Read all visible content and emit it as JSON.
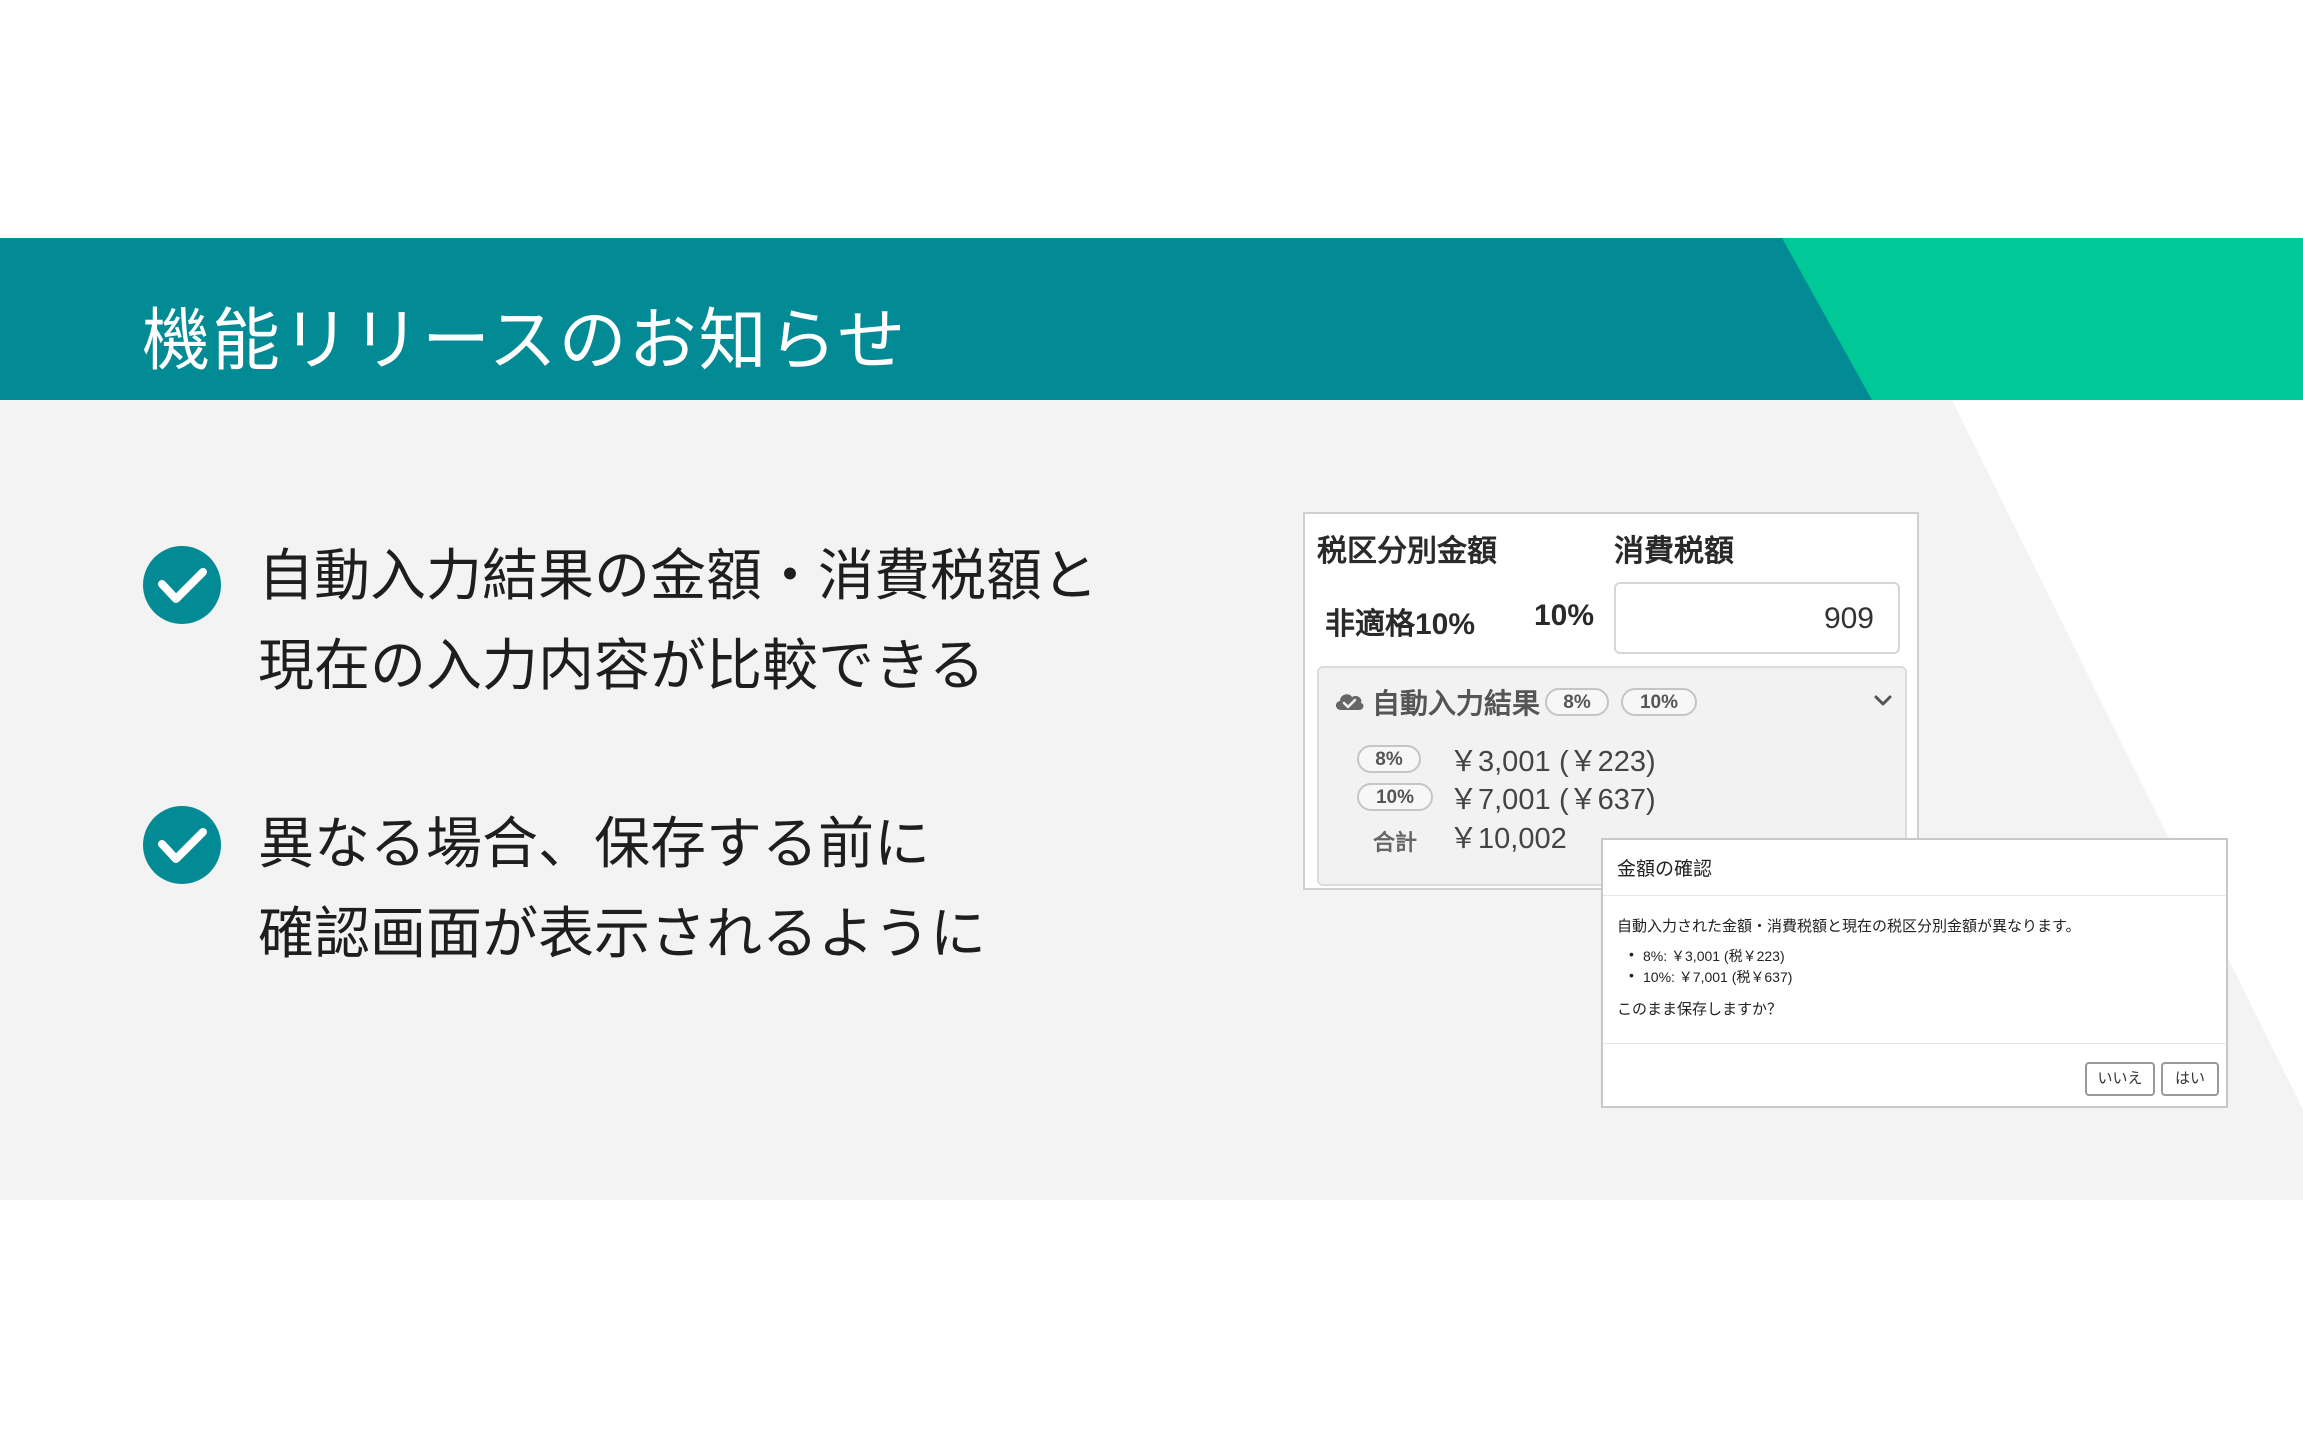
{
  "header": {
    "title": "機能リリースのお知らせ",
    "colors": {
      "teal": "#028a95",
      "green": "#00c896"
    }
  },
  "features": [
    {
      "icon": "check-circle-icon",
      "lines": [
        "自動入力結果の金額・消費税額と",
        "現在の入力内容が比較できる"
      ]
    },
    {
      "icon": "check-circle-icon",
      "lines": [
        "異なる場合、保存する前に",
        "確認画面が表示されるように"
      ]
    }
  ],
  "tax_panel": {
    "header_category": "税区分別金額",
    "header_tax": "消費税額",
    "row_label": "非適格10%",
    "row_rate": "10%",
    "tax_input_value": "909",
    "auto_result": {
      "icon": "cloud-check-icon",
      "title": "自動入力結果",
      "tags": [
        "8%",
        "10%"
      ],
      "expand_icon": "chevron-down-icon",
      "rows": [
        {
          "rate": "8%",
          "amount": "￥3,001",
          "tax": "(￥223)"
        },
        {
          "rate": "10%",
          "amount": "￥7,001",
          "tax": "(￥637)"
        }
      ],
      "total_label": "合計",
      "total_amount": "￥10,002"
    }
  },
  "dialog": {
    "title": "金額の確認",
    "message": "自動入力された金額・消費税額と現在の税区分別金額が異なります。",
    "items": [
      "8%: ￥3,001 (税￥223)",
      "10%: ￥7,001 (税￥637)"
    ],
    "question": "このまま保存しますか？",
    "no_label": "いいえ",
    "yes_label": "はい"
  }
}
